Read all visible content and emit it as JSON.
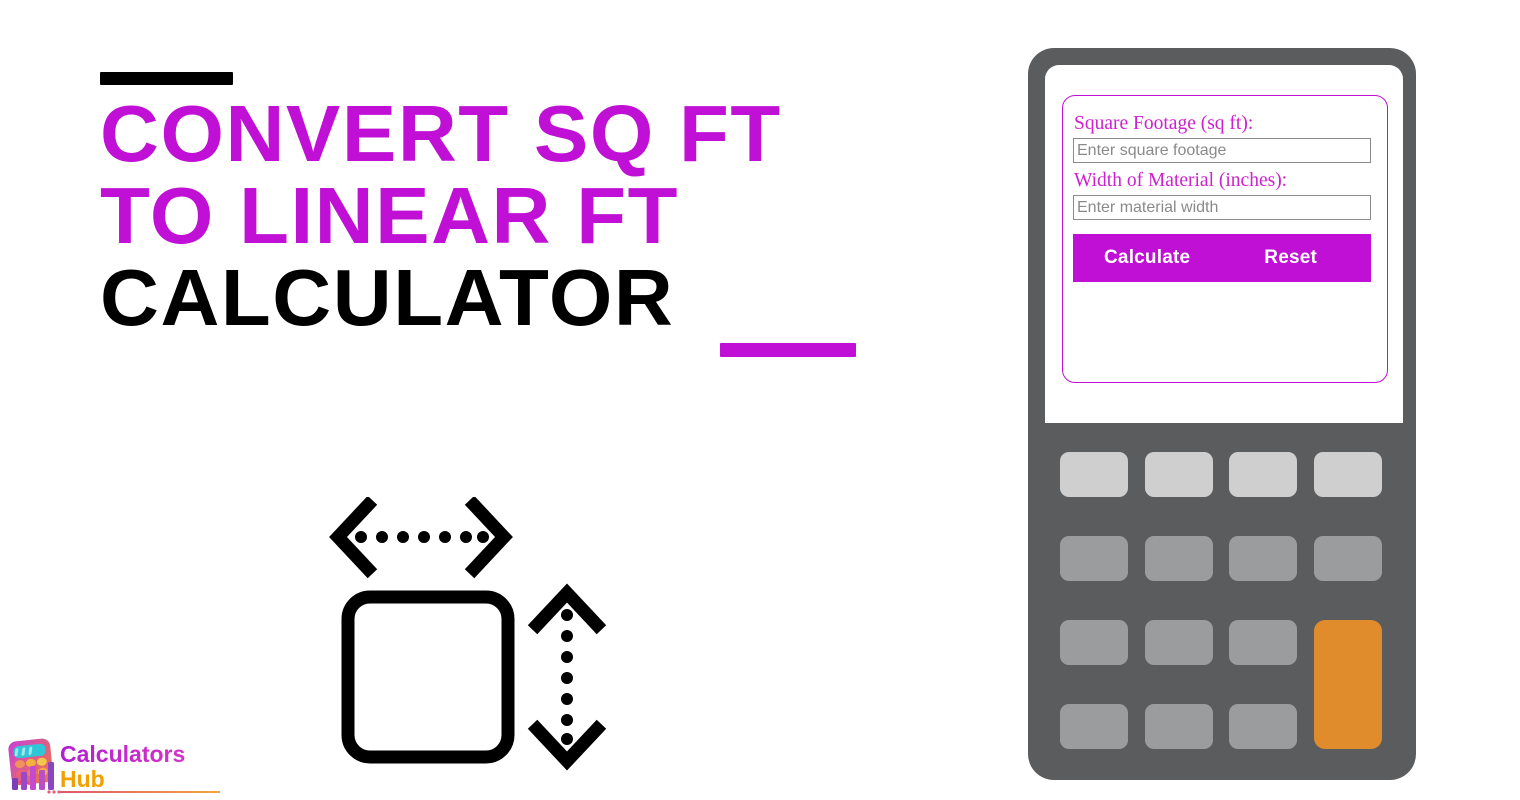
{
  "hero": {
    "title_lines": [
      {
        "text": "Convert Sq Ft",
        "color": "#C010D5"
      },
      {
        "text": "To Linear Ft",
        "color": "#C010D5"
      },
      {
        "text": "Calculator",
        "color": "#000000"
      }
    ],
    "accent_dash_top_color": "#000000",
    "accent_dash_bottom_color": "#C010D5",
    "illustration": {
      "name": "dimension-square-icon",
      "description": "Rounded square with horizontal and vertical dotted double-headed measurement arrows",
      "stroke_color": "#000000"
    }
  },
  "logo": {
    "name_line1": "Calculators",
    "name_line2": "Hub",
    "line1_color": "#C010D5",
    "line2_color": "#F2A000",
    "icon_name": "calculator-bars-logo-icon"
  },
  "calculator": {
    "device_color": "#5b5c5e",
    "screen_color": "#ffffff",
    "accent_color": "#C010D5",
    "form": {
      "card_border_color": "#C010D5",
      "fields": [
        {
          "id": "square-footage",
          "label": "Square Footage (sq ft):",
          "placeholder": "Enter square footage",
          "value": ""
        },
        {
          "id": "material-width",
          "label": "Width of Material (inches):",
          "placeholder": "Enter material width",
          "value": ""
        }
      ],
      "buttons": [
        {
          "id": "calculate",
          "label": "Calculate"
        },
        {
          "id": "reset",
          "label": "Reset"
        }
      ]
    },
    "keypad": {
      "rows": 4,
      "columns": 4,
      "light_key_color": "#cfcfcf",
      "normal_key_color": "#9b9c9d",
      "accent_key_color": "#e08b2c",
      "accent_key_span": "rows 3-4, column 4"
    }
  }
}
